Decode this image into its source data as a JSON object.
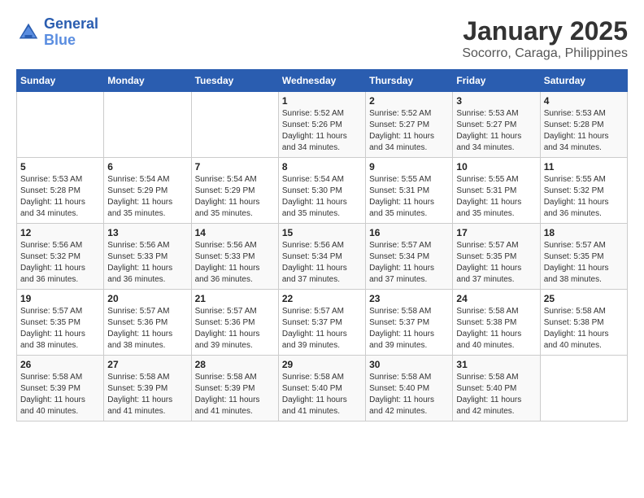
{
  "header": {
    "logo_line1": "General",
    "logo_line2": "Blue",
    "month": "January 2025",
    "location": "Socorro, Caraga, Philippines"
  },
  "weekdays": [
    "Sunday",
    "Monday",
    "Tuesday",
    "Wednesday",
    "Thursday",
    "Friday",
    "Saturday"
  ],
  "weeks": [
    [
      {
        "day": "",
        "sunrise": "",
        "sunset": "",
        "daylight": ""
      },
      {
        "day": "",
        "sunrise": "",
        "sunset": "",
        "daylight": ""
      },
      {
        "day": "",
        "sunrise": "",
        "sunset": "",
        "daylight": ""
      },
      {
        "day": "1",
        "sunrise": "Sunrise: 5:52 AM",
        "sunset": "Sunset: 5:26 PM",
        "daylight": "Daylight: 11 hours and 34 minutes."
      },
      {
        "day": "2",
        "sunrise": "Sunrise: 5:52 AM",
        "sunset": "Sunset: 5:27 PM",
        "daylight": "Daylight: 11 hours and 34 minutes."
      },
      {
        "day": "3",
        "sunrise": "Sunrise: 5:53 AM",
        "sunset": "Sunset: 5:27 PM",
        "daylight": "Daylight: 11 hours and 34 minutes."
      },
      {
        "day": "4",
        "sunrise": "Sunrise: 5:53 AM",
        "sunset": "Sunset: 5:28 PM",
        "daylight": "Daylight: 11 hours and 34 minutes."
      }
    ],
    [
      {
        "day": "5",
        "sunrise": "Sunrise: 5:53 AM",
        "sunset": "Sunset: 5:28 PM",
        "daylight": "Daylight: 11 hours and 34 minutes."
      },
      {
        "day": "6",
        "sunrise": "Sunrise: 5:54 AM",
        "sunset": "Sunset: 5:29 PM",
        "daylight": "Daylight: 11 hours and 35 minutes."
      },
      {
        "day": "7",
        "sunrise": "Sunrise: 5:54 AM",
        "sunset": "Sunset: 5:29 PM",
        "daylight": "Daylight: 11 hours and 35 minutes."
      },
      {
        "day": "8",
        "sunrise": "Sunrise: 5:54 AM",
        "sunset": "Sunset: 5:30 PM",
        "daylight": "Daylight: 11 hours and 35 minutes."
      },
      {
        "day": "9",
        "sunrise": "Sunrise: 5:55 AM",
        "sunset": "Sunset: 5:31 PM",
        "daylight": "Daylight: 11 hours and 35 minutes."
      },
      {
        "day": "10",
        "sunrise": "Sunrise: 5:55 AM",
        "sunset": "Sunset: 5:31 PM",
        "daylight": "Daylight: 11 hours and 35 minutes."
      },
      {
        "day": "11",
        "sunrise": "Sunrise: 5:55 AM",
        "sunset": "Sunset: 5:32 PM",
        "daylight": "Daylight: 11 hours and 36 minutes."
      }
    ],
    [
      {
        "day": "12",
        "sunrise": "Sunrise: 5:56 AM",
        "sunset": "Sunset: 5:32 PM",
        "daylight": "Daylight: 11 hours and 36 minutes."
      },
      {
        "day": "13",
        "sunrise": "Sunrise: 5:56 AM",
        "sunset": "Sunset: 5:33 PM",
        "daylight": "Daylight: 11 hours and 36 minutes."
      },
      {
        "day": "14",
        "sunrise": "Sunrise: 5:56 AM",
        "sunset": "Sunset: 5:33 PM",
        "daylight": "Daylight: 11 hours and 36 minutes."
      },
      {
        "day": "15",
        "sunrise": "Sunrise: 5:56 AM",
        "sunset": "Sunset: 5:34 PM",
        "daylight": "Daylight: 11 hours and 37 minutes."
      },
      {
        "day": "16",
        "sunrise": "Sunrise: 5:57 AM",
        "sunset": "Sunset: 5:34 PM",
        "daylight": "Daylight: 11 hours and 37 minutes."
      },
      {
        "day": "17",
        "sunrise": "Sunrise: 5:57 AM",
        "sunset": "Sunset: 5:35 PM",
        "daylight": "Daylight: 11 hours and 37 minutes."
      },
      {
        "day": "18",
        "sunrise": "Sunrise: 5:57 AM",
        "sunset": "Sunset: 5:35 PM",
        "daylight": "Daylight: 11 hours and 38 minutes."
      }
    ],
    [
      {
        "day": "19",
        "sunrise": "Sunrise: 5:57 AM",
        "sunset": "Sunset: 5:35 PM",
        "daylight": "Daylight: 11 hours and 38 minutes."
      },
      {
        "day": "20",
        "sunrise": "Sunrise: 5:57 AM",
        "sunset": "Sunset: 5:36 PM",
        "daylight": "Daylight: 11 hours and 38 minutes."
      },
      {
        "day": "21",
        "sunrise": "Sunrise: 5:57 AM",
        "sunset": "Sunset: 5:36 PM",
        "daylight": "Daylight: 11 hours and 39 minutes."
      },
      {
        "day": "22",
        "sunrise": "Sunrise: 5:57 AM",
        "sunset": "Sunset: 5:37 PM",
        "daylight": "Daylight: 11 hours and 39 minutes."
      },
      {
        "day": "23",
        "sunrise": "Sunrise: 5:58 AM",
        "sunset": "Sunset: 5:37 PM",
        "daylight": "Daylight: 11 hours and 39 minutes."
      },
      {
        "day": "24",
        "sunrise": "Sunrise: 5:58 AM",
        "sunset": "Sunset: 5:38 PM",
        "daylight": "Daylight: 11 hours and 40 minutes."
      },
      {
        "day": "25",
        "sunrise": "Sunrise: 5:58 AM",
        "sunset": "Sunset: 5:38 PM",
        "daylight": "Daylight: 11 hours and 40 minutes."
      }
    ],
    [
      {
        "day": "26",
        "sunrise": "Sunrise: 5:58 AM",
        "sunset": "Sunset: 5:39 PM",
        "daylight": "Daylight: 11 hours and 40 minutes."
      },
      {
        "day": "27",
        "sunrise": "Sunrise: 5:58 AM",
        "sunset": "Sunset: 5:39 PM",
        "daylight": "Daylight: 11 hours and 41 minutes."
      },
      {
        "day": "28",
        "sunrise": "Sunrise: 5:58 AM",
        "sunset": "Sunset: 5:39 PM",
        "daylight": "Daylight: 11 hours and 41 minutes."
      },
      {
        "day": "29",
        "sunrise": "Sunrise: 5:58 AM",
        "sunset": "Sunset: 5:40 PM",
        "daylight": "Daylight: 11 hours and 41 minutes."
      },
      {
        "day": "30",
        "sunrise": "Sunrise: 5:58 AM",
        "sunset": "Sunset: 5:40 PM",
        "daylight": "Daylight: 11 hours and 42 minutes."
      },
      {
        "day": "31",
        "sunrise": "Sunrise: 5:58 AM",
        "sunset": "Sunset: 5:40 PM",
        "daylight": "Daylight: 11 hours and 42 minutes."
      },
      {
        "day": "",
        "sunrise": "",
        "sunset": "",
        "daylight": ""
      }
    ]
  ]
}
